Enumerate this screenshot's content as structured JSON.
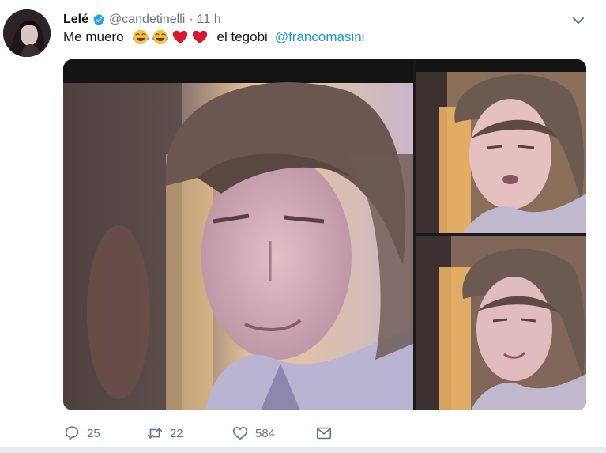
{
  "tweet": {
    "display_name": "Lelé",
    "handle": "@candetinelli",
    "separator": "·",
    "time": "11 h",
    "text_before": "Me muero",
    "text_after": "el tegobi",
    "mention": "@francomasini",
    "emojis": [
      "face-with-tears-of-joy",
      "face-with-tears-of-joy",
      "red-heart",
      "red-heart"
    ]
  },
  "actions": {
    "reply_count": "25",
    "retweet_count": "22",
    "like_count": "584"
  },
  "colors": {
    "accent": "#1b95e0",
    "muted": "#657786",
    "text": "#14171a",
    "heart": "#e0245e"
  },
  "icons": {
    "verified": "verified-badge-icon",
    "more": "chevron-down-icon",
    "reply": "reply-icon",
    "retweet": "retweet-icon",
    "like": "heart-icon",
    "dm": "envelope-icon"
  }
}
